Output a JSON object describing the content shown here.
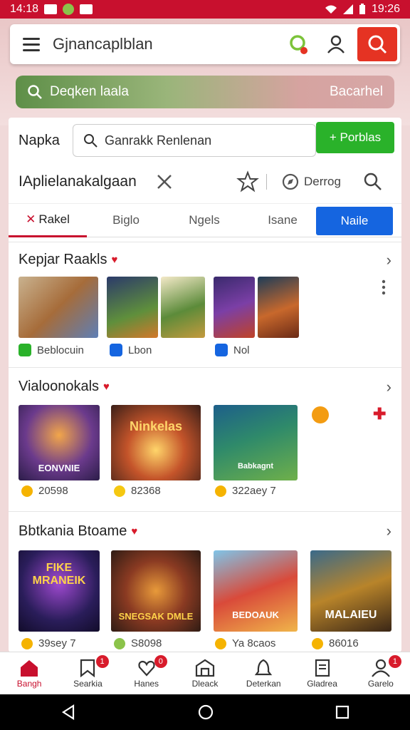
{
  "status": {
    "time_left": "14:18",
    "time_right": "19:26"
  },
  "topbar": {
    "title": "Gjnancaplblan"
  },
  "promo": {
    "text": "Deqken laala",
    "right_text": "Bacarhel"
  },
  "search_row": {
    "label": "Napka",
    "placeholder": "Ganrakk Renlenan",
    "button": "+ Porblas"
  },
  "app_row": {
    "title": "IAplielanakalgaan",
    "filter_label": "Derrog"
  },
  "tabs": [
    {
      "label": "Rakel"
    },
    {
      "label": "Biglo"
    },
    {
      "label": "Ngels"
    },
    {
      "label": "Isane"
    },
    {
      "label": "Naile"
    }
  ],
  "sections": [
    {
      "title": "Kepjar Raakls",
      "metas": [
        "Beblocuin",
        "Lbon",
        "Nol"
      ]
    },
    {
      "title": "Vialoonokals",
      "metas": [
        "20598",
        "82368",
        "322aey 7"
      ]
    },
    {
      "title": "Bbtkania Btoame",
      "metas": [
        "39sey 7",
        "S8098",
        "Ya 8caos",
        "86016"
      ],
      "thumb_titles": [
        "FIKE MRANEIK",
        "SNEGSAK DMLE",
        "BEDOAUK",
        "MALAIEU"
      ]
    }
  ],
  "section2_thumb_titles": [
    "EONVNIE",
    "Ninkelas",
    "Babkagnt"
  ],
  "bottom_nav": [
    {
      "label": "Bangh",
      "icon": "home-icon"
    },
    {
      "label": "Searkia",
      "icon": "bookmark-icon",
      "badge": "1"
    },
    {
      "label": "Hanes",
      "icon": "heart-icon",
      "badge": "0"
    },
    {
      "label": "Dleack",
      "icon": "store-icon"
    },
    {
      "label": "Deterkan",
      "icon": "bell-icon"
    },
    {
      "label": "Gladrea",
      "icon": "document-icon"
    },
    {
      "label": "Garelo",
      "icon": "profile-icon",
      "badge": "1"
    }
  ],
  "colors": {
    "accent": "#c8102e",
    "green": "#2ab22a",
    "blue": "#1565e0"
  }
}
